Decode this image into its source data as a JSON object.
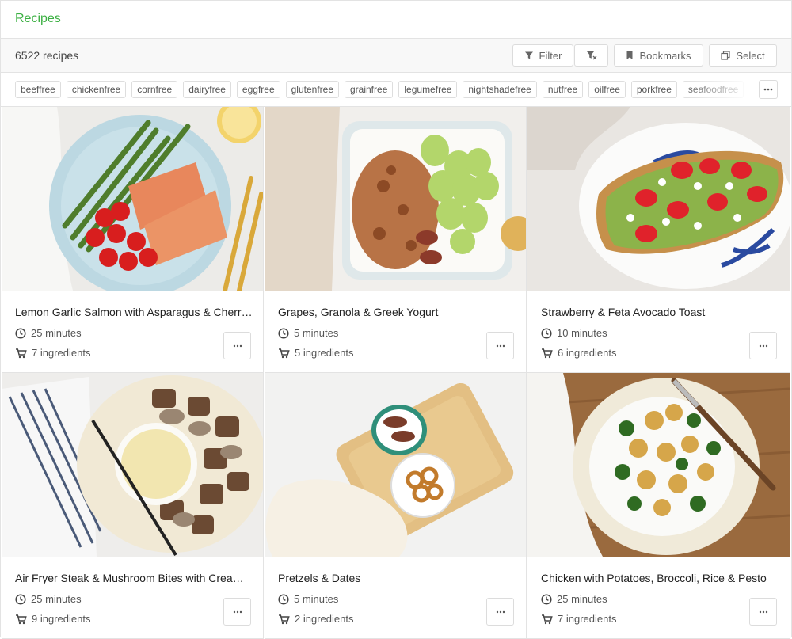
{
  "header": {
    "title": "Recipes"
  },
  "toolbar": {
    "count_label": "6522 recipes",
    "filter_label": "Filter",
    "bookmarks_label": "Bookmarks",
    "select_label": "Select"
  },
  "tags": [
    "beeffree",
    "chickenfree",
    "cornfree",
    "dairyfree",
    "eggfree",
    "glutenfree",
    "grainfree",
    "legumefree",
    "nightshadefree",
    "nutfree",
    "oilfree",
    "porkfree",
    "seafoodfree"
  ],
  "recipes": [
    {
      "title": "Lemon Garlic Salmon with Asparagus & Cherry Tomatoes",
      "time": "25 minutes",
      "ingredients": "7 ingredients"
    },
    {
      "title": "Grapes, Granola & Greek Yogurt",
      "time": "5 minutes",
      "ingredients": "5 ingredients"
    },
    {
      "title": "Strawberry & Feta Avocado Toast",
      "time": "10 minutes",
      "ingredients": "6 ingredients"
    },
    {
      "title": "Air Fryer Steak & Mushroom Bites with Creamy Dip",
      "time": "25 minutes",
      "ingredients": "9 ingredients"
    },
    {
      "title": "Pretzels & Dates",
      "time": "5 minutes",
      "ingredients": "2 ingredients"
    },
    {
      "title": "Chicken with Potatoes, Broccoli, Rice & Pesto",
      "time": "25 minutes",
      "ingredients": "7 ingredients"
    }
  ],
  "colors": {
    "accent": "#3cb043",
    "border": "#e3e3e3",
    "toolbar_bg": "#f8f8f8"
  }
}
